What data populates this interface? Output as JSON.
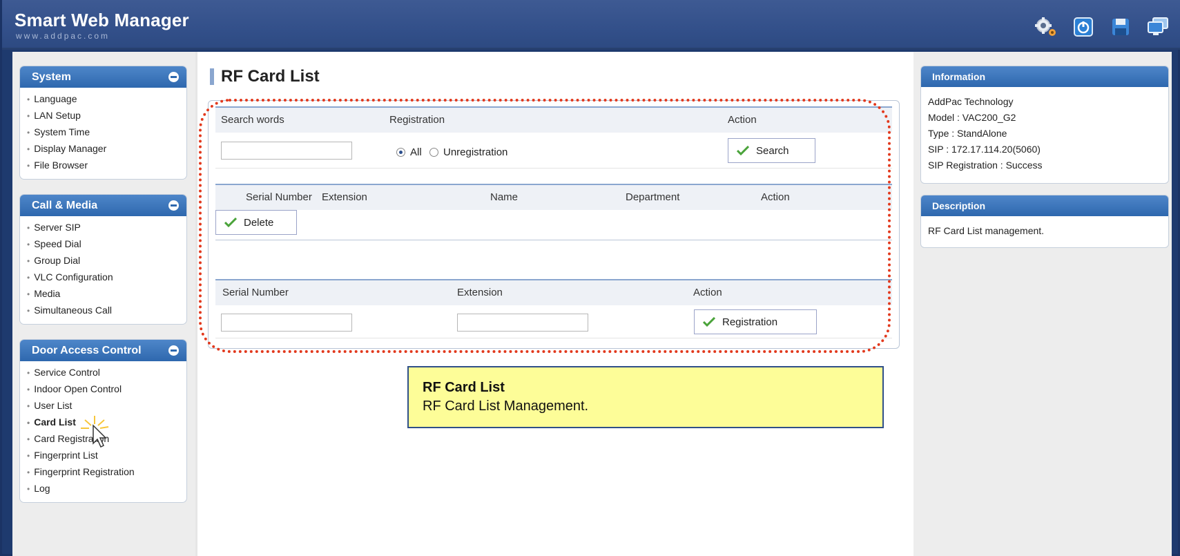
{
  "app": {
    "title": "Smart Web Manager",
    "subtitle": "www.addpac.com"
  },
  "header_icons": [
    "settings-gear-icon",
    "power-icon",
    "save-disk-icon",
    "monitor-icon"
  ],
  "sidebar": {
    "system": {
      "title": "System",
      "items": [
        "Language",
        "LAN Setup",
        "System Time",
        "Display Manager",
        "File Browser"
      ]
    },
    "call_media": {
      "title": "Call & Media",
      "items": [
        "Server SIP",
        "Speed Dial",
        "Group Dial",
        "VLC Configuration",
        "Media",
        "Simultaneous Call"
      ]
    },
    "door": {
      "title": "Door Access Control",
      "items": [
        "Service Control",
        "Indoor Open Control",
        "User List",
        "Card List",
        "Card Registration",
        "Fingerprint List",
        "Fingerprint Registration",
        "Log"
      ],
      "active": "Card List"
    }
  },
  "main": {
    "title": "RF Card List",
    "search": {
      "col_search_words": "Search words",
      "col_registration": "Registration",
      "col_action": "Action",
      "search_value": "",
      "radio_all": "All",
      "radio_unreg": "Unregistration",
      "selected": "All",
      "search_button": "Search"
    },
    "list": {
      "col_serial": "Serial Number",
      "col_extension": "Extension",
      "col_name": "Name",
      "col_department": "Department",
      "col_action": "Action",
      "delete_button": "Delete"
    },
    "register": {
      "col_serial": "Serial Number",
      "col_extension": "Extension",
      "col_action": "Action",
      "serial_value": "",
      "extension_value": "",
      "registration_button": "Registration"
    }
  },
  "callout": {
    "title": "RF Card List",
    "text": "RF Card List Management."
  },
  "info": {
    "title": "Information",
    "lines": [
      "AddPac Technology",
      "Model : VAC200_G2",
      "Type : StandAlone",
      "SIP : 172.17.114.20(5060)",
      "SIP Registration : Success"
    ]
  },
  "description": {
    "title": "Description",
    "text": "RF Card List management."
  },
  "colors": {
    "header": "#33508a",
    "panel_head": "#2e68ae",
    "highlight_border": "#e2391d",
    "callout_bg": "#fdfd98"
  }
}
